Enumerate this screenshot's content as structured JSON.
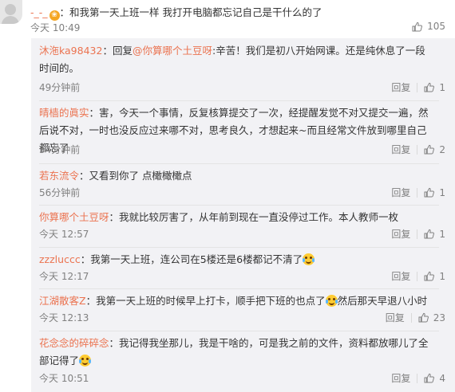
{
  "main_comment": {
    "username": "-_-_",
    "badge": "❀",
    "text": "：和我第一天上班一样 我打开电脑都忘记自己是干什么的了",
    "time": "今天 10:49",
    "likes": "105"
  },
  "replies": [
    {
      "username": "沐沲ka98432",
      "prefix": "：回复",
      "mention": "@你算哪个土豆呀",
      "text": ":辛苦！我们是初八开始网课。还是纯休息了一段时间的。",
      "time": "49分钟前",
      "reply_label": "回复",
      "likes": "1"
    },
    {
      "username": "晴樯的眞实",
      "text": "：害，今天一个事情，反复核算提交了一次，经提醒发觉不对又提交一遍，然后说不对，一时也没反应过来哪不对，思考良久，才想起来~而且经常文件放到哪里自己都忘了",
      "time": "54分钟前",
      "reply_label": "回复",
      "likes": "2"
    },
    {
      "username": "若东流令",
      "text": "：又看到你了 点橄橄橄点",
      "time": "56分钟前",
      "reply_label": "回复",
      "likes": "1"
    },
    {
      "username": "你算哪个土豆呀",
      "text": "：我就比较厉害了，从年前到现在一直没停过工作。本人教师一枚",
      "time": "今天 12:57",
      "reply_label": "回复",
      "likes": "1"
    },
    {
      "username": "zzzluccc",
      "text": "：我第一天上班，连公司在5楼还是6楼都记不清了",
      "time": "今天 12:17",
      "reply_label": "回复",
      "likes": "1"
    },
    {
      "username": "江湖散客Z",
      "text": "：我第一天上班的时候早上打卡，顺手把下班的也点了",
      "text_after": "然后那天早退八小时",
      "time": "今天 12:13",
      "reply_label": "回复",
      "likes": "23"
    },
    {
      "username": "花念念的碎碎念",
      "text": "：我记得我坐那儿，我是干啥的，可是我之前的文件，资料都放哪儿了全部记得了",
      "time": "今天 10:51",
      "reply_label": "回复",
      "likes": "4"
    }
  ],
  "colors": {
    "link": "#eb7350",
    "reply_bg": "#f2f2f5"
  },
  "icons": {
    "emoji": "laugh-cry-emoji-icon",
    "like": "thumbs-up-icon"
  }
}
